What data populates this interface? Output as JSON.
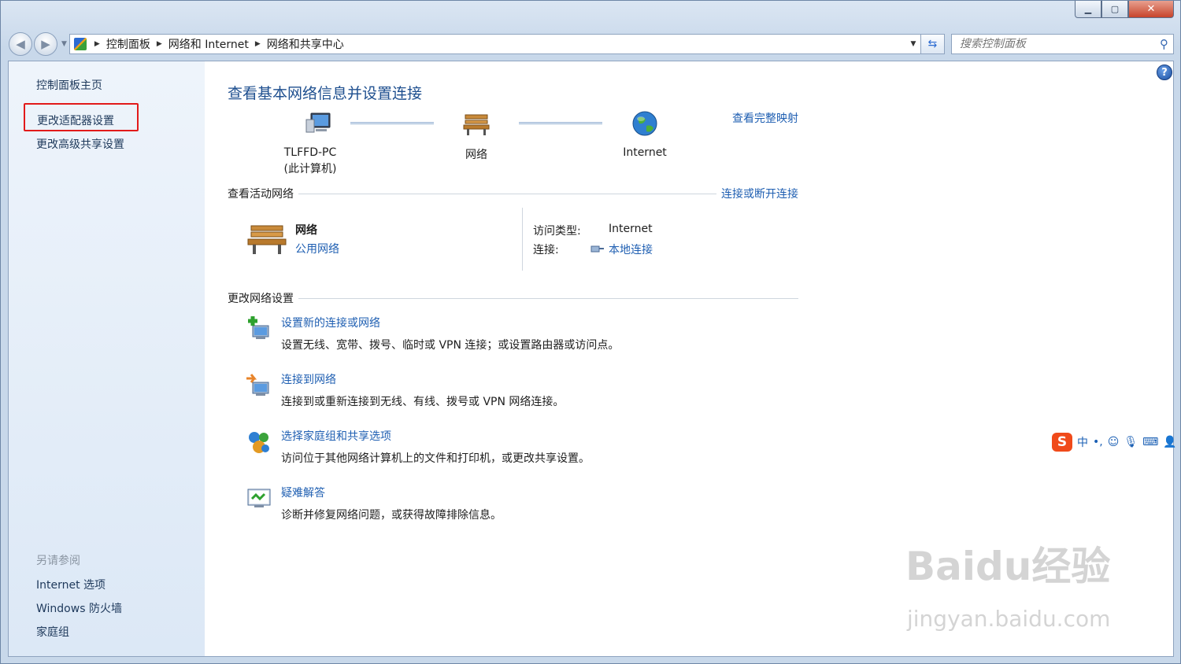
{
  "window": {
    "min": "▁",
    "max": "▢",
    "close": "✕"
  },
  "breadcrumb": [
    "控制面板",
    "网络和 Internet",
    "网络和共享中心"
  ],
  "search": {
    "placeholder": "搜索控制面板"
  },
  "sidebar": {
    "home": "控制面板主页",
    "adapter": "更改适配器设置",
    "advanced": "更改高级共享设置",
    "see_also": "另请参阅",
    "links": [
      "Internet 选项",
      "Windows 防火墙",
      "家庭组"
    ]
  },
  "main": {
    "title": "查看基本网络信息并设置连接",
    "full_map": "查看完整映射",
    "nodes": [
      {
        "name": "TLFFD-PC",
        "sub": "(此计算机)"
      },
      {
        "name": "网络"
      },
      {
        "name": "Internet"
      }
    ],
    "active_networks": "查看活动网络",
    "connect_disconnect": "连接或断开连接",
    "network": {
      "name": "网络",
      "type": "公用网络"
    },
    "access_type_label": "访问类型:",
    "access_type_value": "Internet",
    "connections_label": "连接:",
    "connections_value": "本地连接",
    "change_settings": "更改网络设置",
    "tasks": [
      {
        "title": "设置新的连接或网络",
        "desc": "设置无线、宽带、拨号、临时或 VPN 连接；或设置路由器或访问点。"
      },
      {
        "title": "连接到网络",
        "desc": "连接到或重新连接到无线、有线、拨号或 VPN 网络连接。"
      },
      {
        "title": "选择家庭组和共享选项",
        "desc": "访问位于其他网络计算机上的文件和打印机，或更改共享设置。"
      },
      {
        "title": "疑难解答",
        "desc": "诊断并修复网络问题，或获得故障排除信息。"
      }
    ]
  },
  "ime": {
    "logo": "S",
    "mode": "中",
    "punct": "•,"
  },
  "watermark": {
    "brand": "Baidu经验",
    "url": "jingyan.baidu.com"
  }
}
